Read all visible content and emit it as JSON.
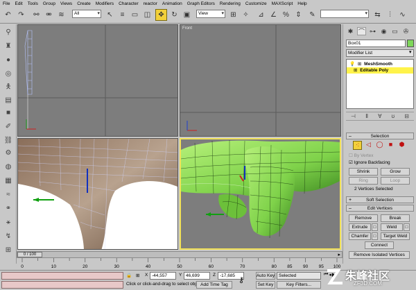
{
  "menu": [
    "File",
    "Edit",
    "Tools",
    "Group",
    "Views",
    "Create",
    "Modifiers",
    "Character",
    "reactor",
    "Animation",
    "Graph Editors",
    "Rendering",
    "Customize",
    "MAXScript",
    "Help"
  ],
  "toolbar": {
    "selection_filter": "All",
    "reference_coord": "View"
  },
  "viewports": {
    "top_right_label": "Front"
  },
  "command_panel": {
    "object_name": "Box01",
    "object_color": "#7fd85a",
    "modifier_list_label": "Modifier List",
    "stack": [
      {
        "name": "MeshSmooth",
        "selected": false
      },
      {
        "name": "Editable Poly",
        "selected": true
      }
    ],
    "selection": {
      "title": "Selection",
      "by_vertex": "By Vertex",
      "ignore_backfacing": "Ignore Backfacing",
      "ignore_backfacing_checked": true,
      "shrink": "Shrink",
      "grow": "Grow",
      "ring": "Ring",
      "loop": "Loop",
      "status": "2 Vertices Selected"
    },
    "soft_selection": {
      "title": "Soft Selection"
    },
    "edit_vertices": {
      "title": "Edit Vertices",
      "remove": "Remove",
      "break": "Break",
      "extrude": "Extrude",
      "weld": "Weld",
      "chamfer": "Chamfer",
      "target_weld": "Target Weld",
      "connect": "Connect",
      "remove_isolated": "Remove Isolated Vertices"
    }
  },
  "timeline": {
    "frame_display": "0 / 100",
    "ticks": [
      0,
      10,
      20,
      30,
      40,
      50,
      60,
      70,
      80,
      85,
      90,
      95,
      100
    ]
  },
  "status_bar": {
    "x_label": "X",
    "x_value": "-44,557",
    "y_label": "Y",
    "y_value": "46,699",
    "z_label": "Z",
    "z_value": "-17,685",
    "auto_key": "Auto Key",
    "selected_option": "Selected",
    "set_key": "Set Key",
    "key_filters": "Key Filters...",
    "prompt": "Click or click-and-drag to select obj",
    "add_time_tag": "Add Time Tag"
  },
  "watermark": {
    "text": "朱峰社区",
    "subtext": "ZF3D.COM"
  },
  "colors": {
    "ui_gray": "#c8c8c8",
    "viewport_gray": "#7d7d7d",
    "active_border": "#f2e25a",
    "selection_highlight": "#fff34a",
    "mesh_green": "#8fde56"
  }
}
